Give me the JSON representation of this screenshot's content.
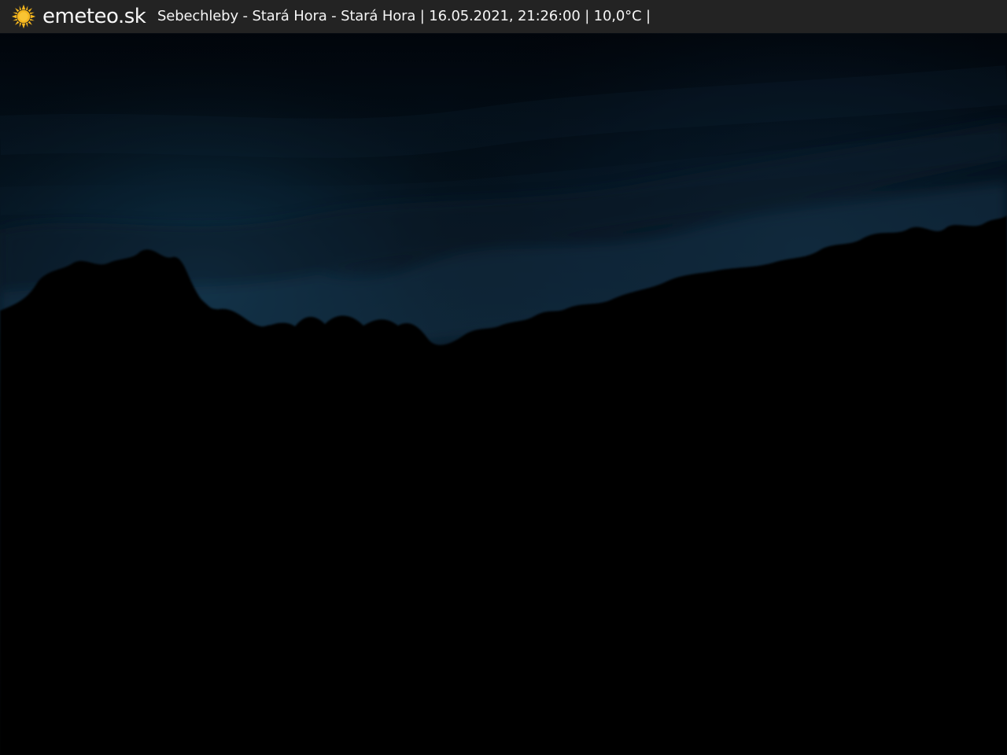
{
  "header": {
    "brand": "emeteo.sk",
    "caption": "Sebechleby - Stará Hora - Stará Hora | 16.05.2021, 21:26:00 | 10,0°C |",
    "logo_icon": "sun-icon"
  },
  "scene": {
    "type": "night webcam view",
    "colors": {
      "sky_top": "#01060d",
      "sky_mid": "#08192a",
      "sky_glow": "#0d2a3d",
      "ground": "#030405"
    }
  }
}
